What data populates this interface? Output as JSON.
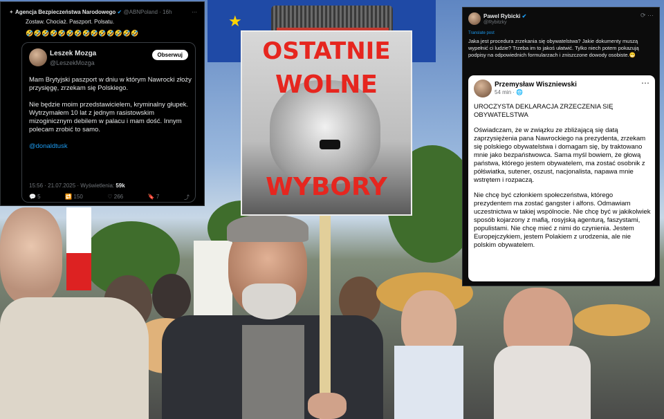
{
  "tweet1": {
    "account_name": "Agencja Bezpieczeństwa Narodowego",
    "account_handle": "@ABNPoland · 16h",
    "text": "Zostaw. Chociaż. Paszport. Polsatu.",
    "emoji_row": "🤣🤣🤣🤣🤣🤣🤣🤣🤣🤣🤣🤣🤣🤣",
    "quote": {
      "name": "Leszek Mozga",
      "handle": "@LeszekMozga",
      "follow_label": "Obserwuj",
      "paragraphs": [
        "Mam Brytyjski paszport w dniu w którym Nawrocki złoży przysięgę, zrzekam się Polskiego.",
        "Nie będzie moim przedstawicielem, kryminalny głupek. Wytrzymałem 10 lat z jednym rasistowskim mizoginicznym debilem w palacu i mam dość. Innym polecam zrobić to samo.",
        "@donaldtusk"
      ],
      "meta_time": "15:56 · 21.07.2025 · Wyświetlenia:",
      "meta_views": "59k",
      "actions": [
        "💬 5",
        "🔁 150",
        "♡ 266",
        "🔖 7",
        "⤴"
      ]
    }
  },
  "tweet2": {
    "name": "Pawel Rybicki",
    "handle": "@Rybitzky",
    "translate_label": "Translate post",
    "text": "Jaka jest procedura zrzekania się obywatelstwa? Jakie dokumenty muszą wypełnić ci ludzie? Trzeba im to jakoś ułatwić. Tylko niech potem pokazują podpisy na odpowiednich formularzach i zniszczone dowody osobiste.😁",
    "card": {
      "name": "Przemysław Wiszniewski",
      "time": "54 min · 🌐",
      "paragraphs": [
        "UROCZYSTA DEKLARACJA ZRZECZENIA SIĘ OBYWATELSTWA",
        "Oświadczam, że w związku ze zbliżającą się datą zaprzysiężenia pana Nawrockiego na prezydenta, zrzekam się polskiego obywatelstwa i domagam się, by traktowano mnie jako bezpaństwowca. Sama myśl bowiem, że głową państwa, którego jestem obywatelem, ma zostać osobnik z półświatka, sutener, oszust, nacjonalista, napawa mnie wstrętem i rozpaczą.",
        "Nie chcę być członkiem społeczeństwa, którego prezydentem ma zostać gangster i alfons. Odmawiam uczestnictwa w takiej wspólnocie. Nie chcę być w jakikolwiek sposób kojarzony z mafią, rosyjską agenturą, faszystami, populistami. Nie chcę mieć z nimi do czynienia. Jestem Europejczykiem, jestem Polakiem z urodzenia, ale nie polskim obywatelem."
      ]
    }
  },
  "sign": {
    "line1": "OSTATNIE",
    "line2": "WOLNE",
    "line3": "WYBORY"
  }
}
